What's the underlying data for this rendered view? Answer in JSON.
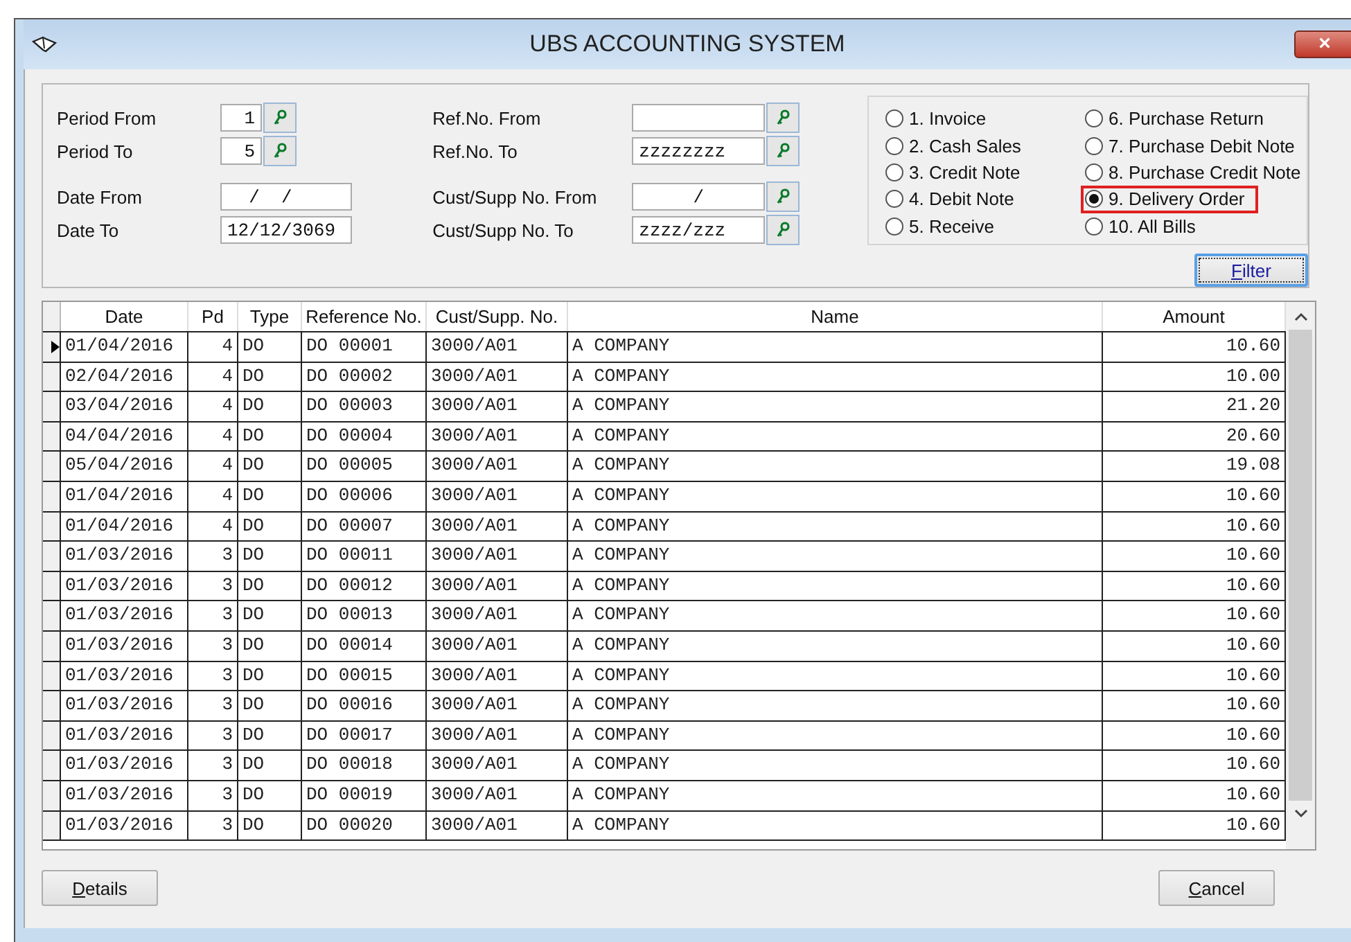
{
  "window": {
    "title": "UBS ACCOUNTING SYSTEM",
    "close": "×"
  },
  "filters_left": [
    {
      "label": "Period From",
      "value": "1",
      "kind": "period",
      "lookup": true
    },
    {
      "label": "Period To",
      "value": "5",
      "kind": "period",
      "lookup": true
    },
    {
      "label": "Date From",
      "value": "  /  /",
      "kind": "date",
      "lookup": false
    },
    {
      "label": "Date To",
      "value": "12/12/3069",
      "kind": "date",
      "lookup": false
    }
  ],
  "filters_right": [
    {
      "label": "Ref.No. From",
      "lookup": true
    },
    {
      "label": "Ref.No. To",
      "value": "zzzzzzzz",
      "lookup": true
    },
    {
      "label": "Cust/Supp No. From",
      "value": "/",
      "lookup": true
    },
    {
      "label": "Cust/Supp No. To",
      "value": "zzzz/zzz",
      "lookup": true
    }
  ],
  "doc_types": [
    {
      "label": "1. Invoice",
      "selected": false,
      "highlighted": false
    },
    {
      "label": "2. Cash Sales",
      "selected": false,
      "highlighted": false
    },
    {
      "label": "3. Credit Note",
      "selected": false,
      "highlighted": false
    },
    {
      "label": "4. Debit Note",
      "selected": false,
      "highlighted": false
    },
    {
      "label": "5. Receive",
      "selected": false,
      "highlighted": false
    },
    {
      "label": "6. Purchase Return",
      "selected": false,
      "highlighted": false
    },
    {
      "label": "7. Purchase Debit Note",
      "selected": false,
      "highlighted": false
    },
    {
      "label": "8. Purchase Credit Note",
      "selected": false,
      "highlighted": false
    },
    {
      "label": "9. Delivery Order",
      "selected": true,
      "highlighted": true
    },
    {
      "label": "10. All Bills",
      "selected": false,
      "highlighted": false
    }
  ],
  "filter_button": "Filter",
  "table": {
    "columns": [
      "Date",
      "Pd",
      "Type",
      "Reference No.",
      "Cust/Supp. No.",
      "Name",
      "Amount"
    ],
    "rows": [
      {
        "selected": true,
        "cells": [
          "01/04/2016",
          "4",
          "DO",
          "DO 00001",
          "3000/A01",
          "A COMPANY",
          "10.60"
        ]
      },
      {
        "selected": false,
        "cells": [
          "02/04/2016",
          "4",
          "DO",
          "DO 00002",
          "3000/A01",
          "A COMPANY",
          "10.00"
        ]
      },
      {
        "selected": false,
        "cells": [
          "03/04/2016",
          "4",
          "DO",
          "DO 00003",
          "3000/A01",
          "A COMPANY",
          "21.20"
        ]
      },
      {
        "selected": false,
        "cells": [
          "04/04/2016",
          "4",
          "DO",
          "DO 00004",
          "3000/A01",
          "A COMPANY",
          "20.60"
        ]
      },
      {
        "selected": false,
        "cells": [
          "05/04/2016",
          "4",
          "DO",
          "DO 00005",
          "3000/A01",
          "A COMPANY",
          "19.08"
        ]
      },
      {
        "selected": false,
        "cells": [
          "01/04/2016",
          "4",
          "DO",
          "DO 00006",
          "3000/A01",
          "A COMPANY",
          "10.60"
        ]
      },
      {
        "selected": false,
        "cells": [
          "01/04/2016",
          "4",
          "DO",
          "DO 00007",
          "3000/A01",
          "A COMPANY",
          "10.60"
        ]
      },
      {
        "selected": false,
        "cells": [
          "01/03/2016",
          "3",
          "DO",
          "DO 00011",
          "3000/A01",
          "A COMPANY",
          "10.60"
        ]
      },
      {
        "selected": false,
        "cells": [
          "01/03/2016",
          "3",
          "DO",
          "DO 00012",
          "3000/A01",
          "A COMPANY",
          "10.60"
        ]
      },
      {
        "selected": false,
        "cells": [
          "01/03/2016",
          "3",
          "DO",
          "DO 00013",
          "3000/A01",
          "A COMPANY",
          "10.60"
        ]
      },
      {
        "selected": false,
        "cells": [
          "01/03/2016",
          "3",
          "DO",
          "DO 00014",
          "3000/A01",
          "A COMPANY",
          "10.60"
        ]
      },
      {
        "selected": false,
        "cells": [
          "01/03/2016",
          "3",
          "DO",
          "DO 00015",
          "3000/A01",
          "A COMPANY",
          "10.60"
        ]
      },
      {
        "selected": false,
        "cells": [
          "01/03/2016",
          "3",
          "DO",
          "DO 00016",
          "3000/A01",
          "A COMPANY",
          "10.60"
        ]
      },
      {
        "selected": false,
        "cells": [
          "01/03/2016",
          "3",
          "DO",
          "DO 00017",
          "3000/A01",
          "A COMPANY",
          "10.60"
        ]
      },
      {
        "selected": false,
        "cells": [
          "01/03/2016",
          "3",
          "DO",
          "DO 00018",
          "3000/A01",
          "A COMPANY",
          "10.60"
        ]
      },
      {
        "selected": false,
        "cells": [
          "01/03/2016",
          "3",
          "DO",
          "DO 00019",
          "3000/A01",
          "A COMPANY",
          "10.60"
        ]
      },
      {
        "selected": false,
        "cells": [
          "01/03/2016",
          "3",
          "DO",
          "DO 00020",
          "3000/A01",
          "A COMPANY",
          "10.60"
        ]
      }
    ]
  },
  "buttons": {
    "details": "Details",
    "cancel": "Cancel"
  }
}
